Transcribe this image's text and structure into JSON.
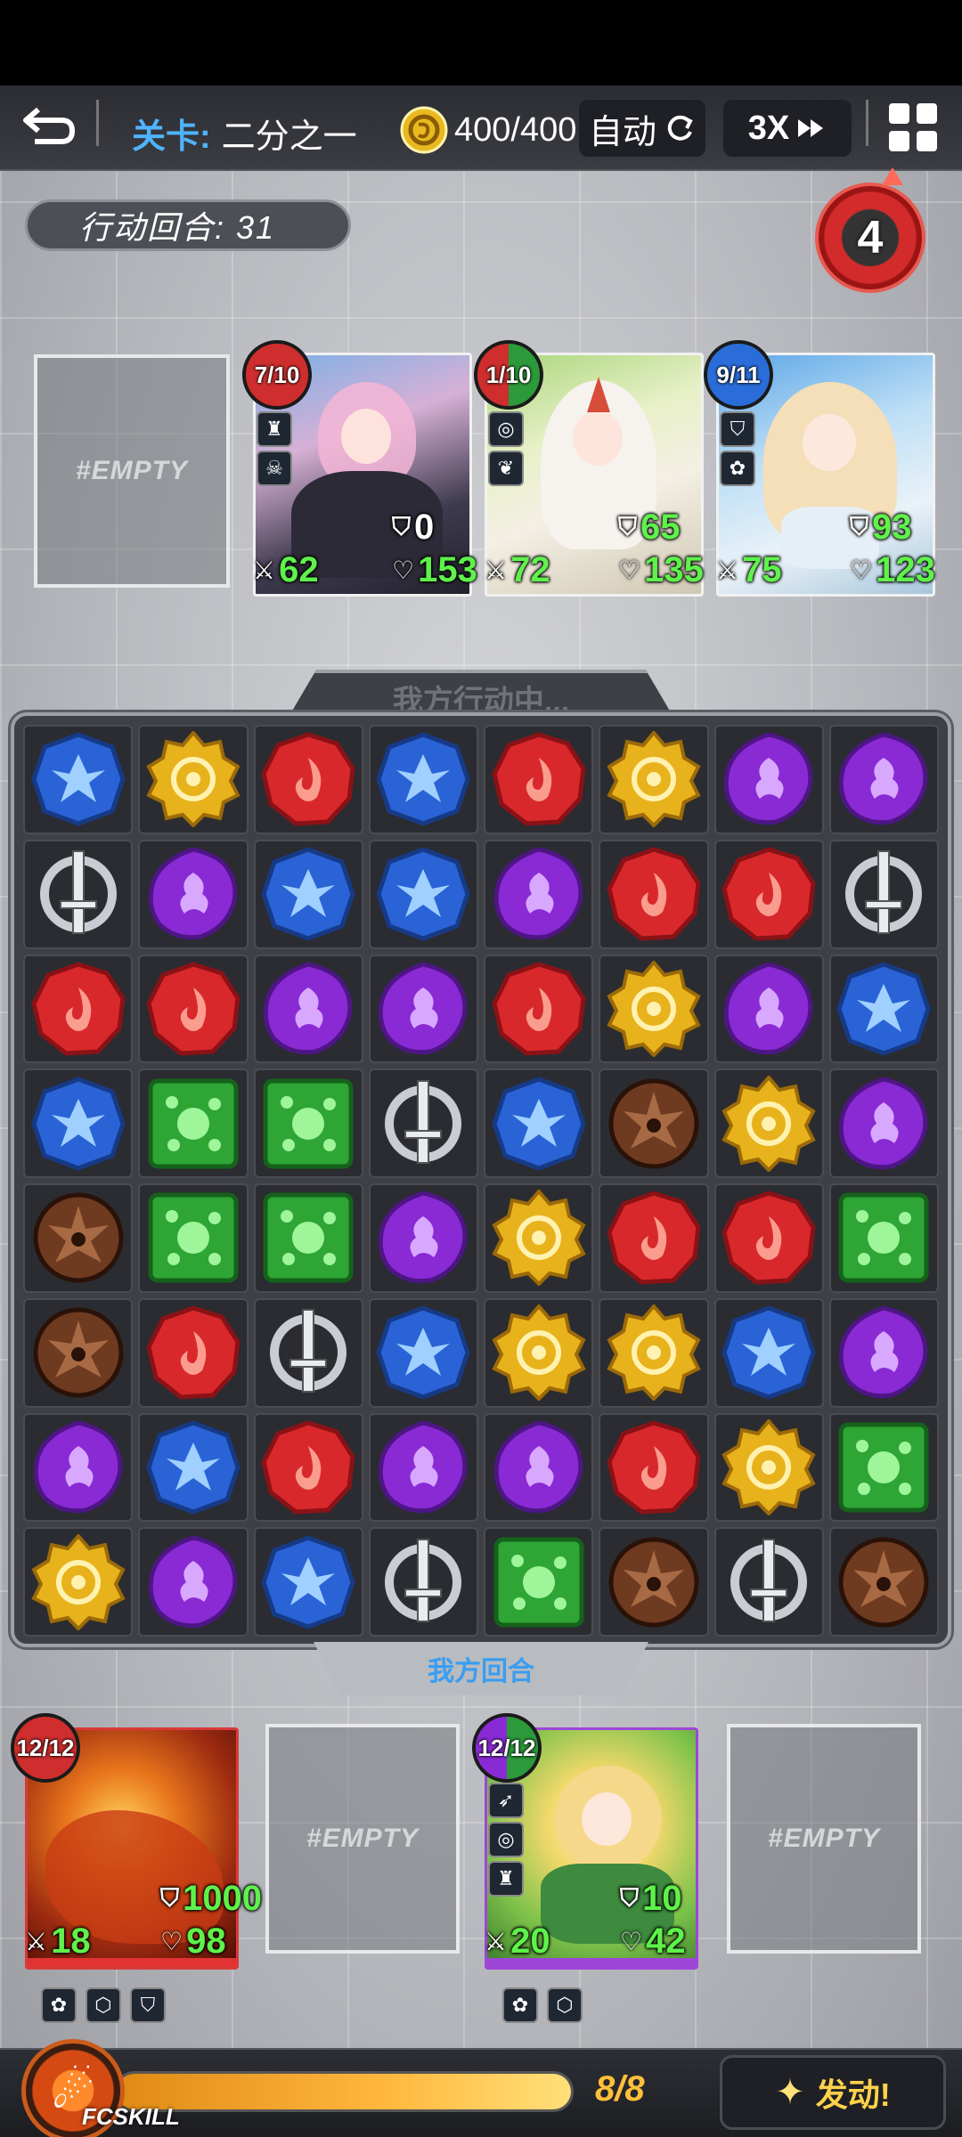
{
  "header": {
    "back_icon": "back-arrow-icon",
    "stage_label": "关卡:",
    "stage_name": "二分之一",
    "energy": "400/400",
    "auto_label": "自动",
    "speed_label": "3X",
    "menu_icon": "grid-menu-icon"
  },
  "turn": {
    "label": "行动回合: 31",
    "countdown": "4"
  },
  "enemies": {
    "empty_label": "#EMPTY",
    "cards": [
      {
        "ratio": "7/10",
        "shield": "0",
        "attack": "62",
        "hp": "153",
        "skills": [
          "tower-skill-icon",
          "skull-skill-icon"
        ],
        "badge_colors": [
          "#cf2e2e",
          "#2a6dd8"
        ]
      },
      {
        "ratio": "1/10",
        "shield": "65",
        "attack": "72",
        "hp": "135",
        "skills": [
          "spiral-skill-icon",
          "heart-skill-icon"
        ],
        "badge_colors": [
          "#cf2e2e",
          "#2c9a3a"
        ]
      },
      {
        "ratio": "9/11",
        "shield": "93",
        "attack": "75",
        "hp": "123",
        "skills": [
          "shield-skill-icon",
          "flower-skill-icon"
        ],
        "badge_colors": [
          "#2a6dd8",
          "#2a6dd8"
        ]
      }
    ]
  },
  "board": {
    "status_top": "我方行动中...",
    "status_bottom": "我方回合",
    "gem_colors": {
      "blue": "#2a63d6",
      "yellow": "#e8b21c",
      "red": "#d9282c",
      "purple": "#8a2ad4",
      "green": "#2ea535",
      "brown": "#6e3a20",
      "sword": "#c9cdd3"
    },
    "rows": [
      [
        "blue",
        "yellow",
        "red",
        "blue",
        "red",
        "yellow",
        "purple",
        "purple"
      ],
      [
        "sword",
        "purple",
        "blue",
        "blue",
        "purple",
        "red",
        "red",
        "sword"
      ],
      [
        "red",
        "red",
        "purple",
        "purple",
        "red",
        "yellow",
        "purple",
        "blue"
      ],
      [
        "blue",
        "green",
        "green",
        "sword",
        "blue",
        "brown",
        "yellow",
        "purple"
      ],
      [
        "brown",
        "green",
        "green",
        "purple",
        "yellow",
        "red",
        "red",
        "green"
      ],
      [
        "brown",
        "red",
        "sword",
        "blue",
        "yellow",
        "yellow",
        "blue",
        "purple"
      ],
      [
        "purple",
        "blue",
        "red",
        "purple",
        "purple",
        "red",
        "yellow",
        "green"
      ],
      [
        "yellow",
        "purple",
        "blue",
        "sword",
        "green",
        "brown",
        "sword",
        "brown"
      ]
    ]
  },
  "allies": {
    "empty_label": "#EMPTY",
    "cards": [
      {
        "ratio": "12/12",
        "shield": "1000",
        "attack": "18",
        "hp": "98",
        "badge_colors": [
          "#cf2e2e",
          "#cf2e2e"
        ],
        "footer_skills": [
          "flower-skill-icon",
          "hex-skill-icon",
          "shield-skill-icon"
        ]
      },
      {
        "ratio": "12/12",
        "shield": "10",
        "attack": "20",
        "hp": "42",
        "badge_colors": [
          "#8a2ad4",
          "#2c9a3a"
        ],
        "skills": [
          "wing-skill-icon",
          "spiral-skill-icon",
          "tower-skill-icon"
        ],
        "footer_skills": [
          "flower-skill-icon",
          "hex-skill-icon"
        ]
      }
    ]
  },
  "footer": {
    "fcskill_label": "FCSKILL",
    "energy_text": "8/8",
    "energy_fraction": 1.0,
    "launch_label": "发动!"
  }
}
